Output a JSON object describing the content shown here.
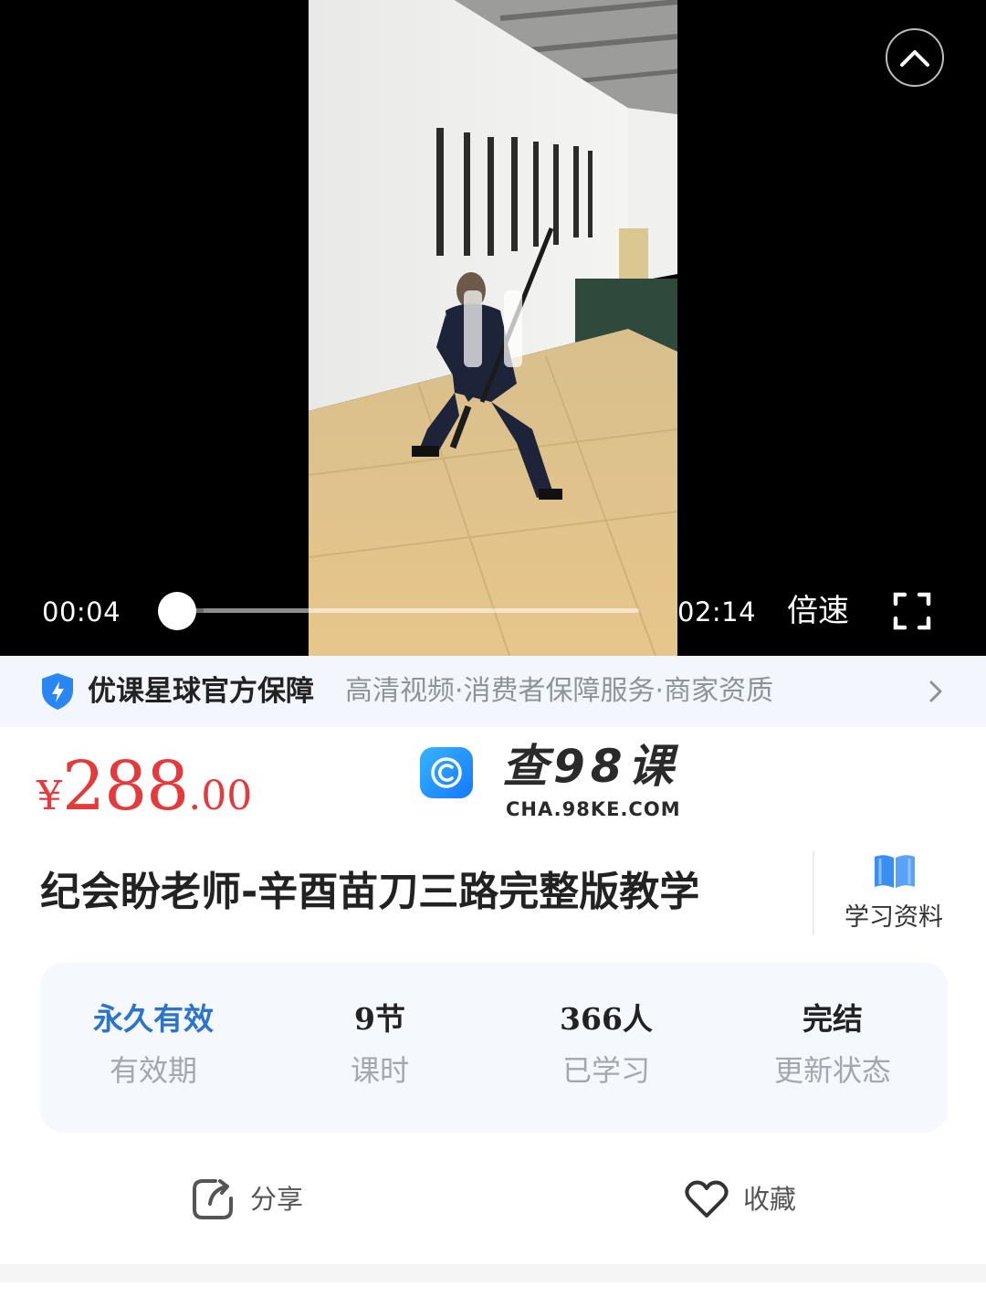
{
  "player": {
    "current_time": "00:04",
    "duration": "02:14",
    "progress_fraction": 0.03,
    "speed_label": "倍速",
    "icons": {
      "collapse": "chevron-up-icon",
      "pause": "pause-icon",
      "fullscreen": "fullscreen-icon"
    }
  },
  "guarantee": {
    "title": "优课星球官方保障",
    "items": "高清视频·消费者保障服务·商家资质",
    "icons": {
      "shield": "shield-icon",
      "arrow": "chevron-right-icon"
    }
  },
  "price": {
    "currency": "¥",
    "integer": "288",
    "decimal": ".00",
    "color": "#e5393b"
  },
  "watermark": {
    "title": "查98课",
    "url": "CHA.98KE.COM"
  },
  "course": {
    "title": "纪会盼老师-辛酉苗刀三路完整版教学",
    "materials_label": "学习资料",
    "materials_icon": "book-icon"
  },
  "stats": [
    {
      "value": "永久有效",
      "label": "有效期"
    },
    {
      "value": "9节",
      "label": "课时"
    },
    {
      "value": "366人",
      "label": "已学习"
    },
    {
      "value": "完结",
      "label": "更新状态"
    }
  ],
  "actions": {
    "share_label": "分享",
    "favorite_label": "收藏",
    "share_icon": "share-icon",
    "favorite_icon": "heart-icon"
  },
  "colors": {
    "accent_blue": "#2d74c9",
    "guarantee_bg": "#f3f7fd",
    "shield_blue": "#2a86f2"
  }
}
